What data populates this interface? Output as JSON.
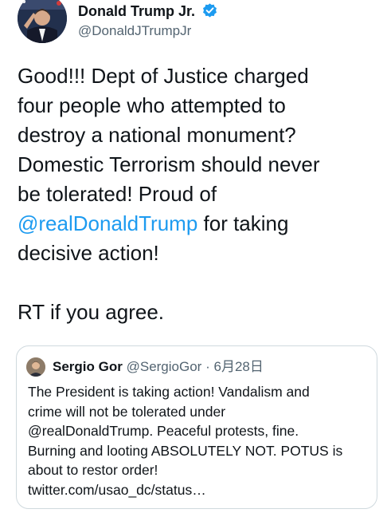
{
  "author": {
    "name": "Donald Trump Jr.",
    "handle": "@DonaldJTrumpJr",
    "verified_icon": "verified-badge-icon"
  },
  "tweet": {
    "lines": [
      "Good!!! Dept of Justice charged",
      "four people who attempted to",
      "destroy a national monument?",
      "Domestic Terrorism should never",
      "be tolerated! Proud of"
    ],
    "mention": "@realDonaldTrump",
    "mention_tail": " for taking",
    "line_after_mention": "decisive action!",
    "closing": "RT if you agree."
  },
  "quote": {
    "name": "Sergio Gor",
    "handle": "@SergioGor",
    "separator": "·",
    "date": "6月28日",
    "lines": [
      "The President is taking action! Vandalism and",
      "crime will not be tolerated under",
      "@realDonaldTrump. Peaceful protests, fine.",
      "Burning and looting ABSOLUTELY NOT. POTUS is",
      "about to restor order!",
      "twitter.com/usao_dc/status…"
    ]
  },
  "colors": {
    "link": "#1d9bf0",
    "text": "#0f1419",
    "secondary": "#536471",
    "border": "#cfd9de"
  }
}
